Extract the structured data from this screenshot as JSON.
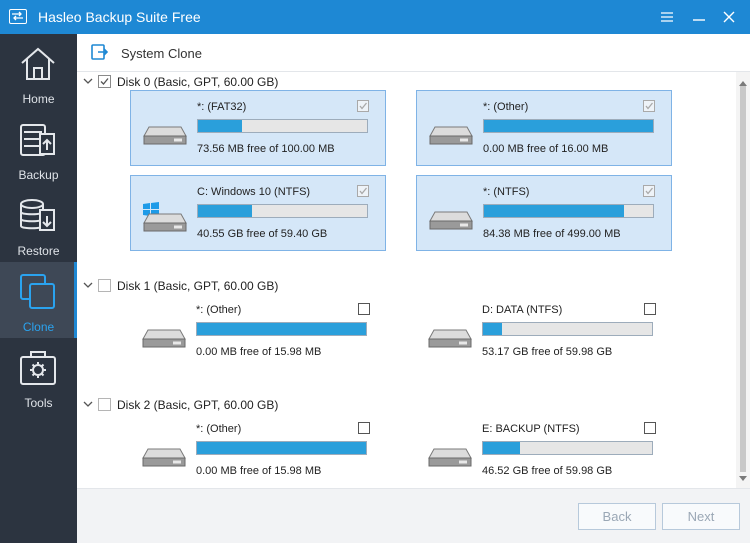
{
  "window": {
    "title": "Hasleo Backup Suite Free"
  },
  "sidebar": {
    "items": [
      {
        "label": "Home",
        "icon": "home-icon"
      },
      {
        "label": "Backup",
        "icon": "backup-icon"
      },
      {
        "label": "Restore",
        "icon": "restore-icon"
      },
      {
        "label": "Clone",
        "icon": "clone-icon",
        "active": true
      },
      {
        "label": "Tools",
        "icon": "tools-icon"
      }
    ]
  },
  "header": {
    "title": "System Clone"
  },
  "disks": [
    {
      "label": "Disk 0 (Basic, GPT, 60.00 GB)",
      "checked": true,
      "partitions": [
        {
          "name": "*: (FAT32)",
          "free": "73.56 MB free of 100.00 MB",
          "used_fraction": 0.26,
          "selected": true,
          "checked": true,
          "icon": "drive-icon"
        },
        {
          "name": "*: (Other)",
          "free": "0.00 MB free of 16.00 MB",
          "used_fraction": 1.0,
          "selected": true,
          "checked": true,
          "icon": "drive-icon"
        },
        {
          "name": "C: Windows 10 (NTFS)",
          "free": "40.55 GB free of 59.40 GB",
          "used_fraction": 0.32,
          "selected": true,
          "checked": true,
          "icon": "windows-drive-icon"
        },
        {
          "name": "*: (NTFS)",
          "free": "84.38 MB free of 499.00 MB",
          "used_fraction": 0.83,
          "selected": true,
          "checked": true,
          "icon": "drive-icon"
        }
      ]
    },
    {
      "label": "Disk 1 (Basic, GPT, 60.00 GB)",
      "checked": false,
      "partitions": [
        {
          "name": "*: (Other)",
          "free": "0.00 MB free of 15.98 MB",
          "used_fraction": 1.0,
          "selected": false,
          "checked": false,
          "icon": "drive-icon"
        },
        {
          "name": "D: DATA (NTFS)",
          "free": "53.17 GB free of 59.98 GB",
          "used_fraction": 0.11,
          "selected": false,
          "checked": false,
          "icon": "drive-icon"
        }
      ]
    },
    {
      "label": "Disk 2 (Basic, GPT, 60.00 GB)",
      "checked": false,
      "partitions": [
        {
          "name": "*: (Other)",
          "free": "0.00 MB free of 15.98 MB",
          "used_fraction": 1.0,
          "selected": false,
          "checked": false,
          "icon": "drive-icon"
        },
        {
          "name": "E: BACKUP (NTFS)",
          "free": "46.52 GB free of 59.98 GB",
          "used_fraction": 0.22,
          "selected": false,
          "checked": false,
          "icon": "drive-icon"
        }
      ]
    }
  ],
  "footer": {
    "back_label": "Back",
    "next_label": "Next"
  },
  "colors": {
    "titlebar": "#1e88d4",
    "sidebar": "#2c3440",
    "bar_fill": "#2a9fdb",
    "selected_bg": "#d5e7f8"
  }
}
